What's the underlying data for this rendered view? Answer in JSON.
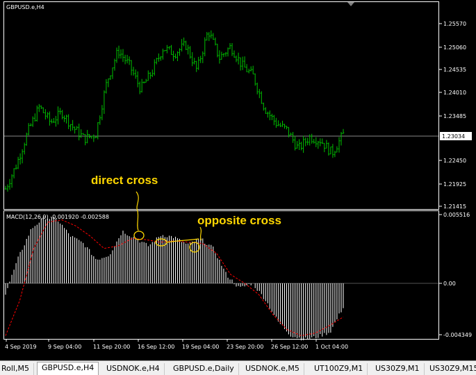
{
  "chart": {
    "symbol_label": "GBPUSD.e,H4",
    "price_ticks": [
      "1.25570",
      "1.25060",
      "1.24535",
      "1.24010",
      "1.23485",
      "1.22450",
      "1.21925",
      "1.21415"
    ],
    "current_price": "1.23034",
    "macd_label": "MACD(12,26,9) -0.001920 -0.002588",
    "macd_ticks": [
      "0.005516",
      "0.00",
      "-0.004349"
    ],
    "time_ticks": [
      "4 Sep 2019",
      "9 Sep 04:00",
      "11 Sep 20:00",
      "16 Sep 12:00",
      "19 Sep 04:00",
      "23 Sep 20:00",
      "26 Sep 12:00",
      "1 Oct 04:00"
    ],
    "annotations": {
      "direct": "direct cross",
      "opposite": "opposite cross"
    },
    "colors": {
      "background": "#000000",
      "candles": "#00c000",
      "histogram": "#ffffff",
      "signal": "#ff0000",
      "grid": "#ffffff",
      "annotation": "#ffd700"
    }
  },
  "tabs": [
    {
      "label": "Roll,M5"
    },
    {
      "label": "GBPUSD.e,H4"
    },
    {
      "label": "USDNOK.e,H4"
    },
    {
      "label": "GBPUSD.e,Daily"
    },
    {
      "label": "USDNOK.e,M5"
    },
    {
      "label": "UT100Z9,M1"
    },
    {
      "label": "US30Z9,M1"
    },
    {
      "label": "US30Z9,M15"
    }
  ],
  "chart_data": {
    "type": "line",
    "title": "GBPUSD.e,H4",
    "x": [
      "4 Sep 2019",
      "9 Sep 04:00",
      "11 Sep 20:00",
      "16 Sep 12:00",
      "19 Sep 04:00",
      "23 Sep 20:00",
      "26 Sep 12:00",
      "1 Oct 04:00"
    ],
    "price_ylim": [
      1.2142,
      1.26
    ],
    "series": [
      {
        "name": "GBPUSD.e,H4",
        "values": [
          1.2181,
          1.2238,
          1.2312,
          1.2368,
          1.2332,
          1.2355,
          1.2321,
          1.2295,
          1.2305,
          1.2425,
          1.2496,
          1.2462,
          1.2408,
          1.2447,
          1.2502,
          1.2489,
          1.2509,
          1.2451,
          1.2541,
          1.2479,
          1.2505,
          1.2462,
          1.2438,
          1.2365,
          1.2331,
          1.2315,
          1.2272,
          1.2299,
          1.2291,
          1.2262,
          1.2305
        ]
      },
      {
        "name": "MACD(12,26,9)",
        "values": [
          -0.0008,
          0.0021,
          0.0044,
          0.0053,
          0.0051,
          0.0038,
          0.0032,
          0.0019,
          0.0023,
          0.0042,
          0.0036,
          0.003,
          0.0039,
          0.0037,
          0.0031,
          0.0036,
          0.0028,
          0.0007,
          -0.0004,
          0.0,
          -0.0013,
          -0.0031,
          -0.0042,
          -0.0045,
          -0.0043,
          -0.0039,
          -0.0019
        ]
      },
      {
        "name": "Signal",
        "values": [
          -0.0042,
          -0.0014,
          0.0028,
          0.0049,
          0.0051,
          0.0046,
          0.0038,
          0.0028,
          0.003,
          0.0036,
          0.0035,
          0.0033,
          0.0034,
          0.0033,
          0.0032,
          0.0024,
          0.0007,
          0.0,
          -0.0009,
          -0.0025,
          -0.0037,
          -0.0042,
          -0.004,
          -0.0034,
          -0.0027
        ]
      }
    ],
    "macd_ylim": [
      -0.004349,
      0.005516
    ],
    "grid": false
  }
}
